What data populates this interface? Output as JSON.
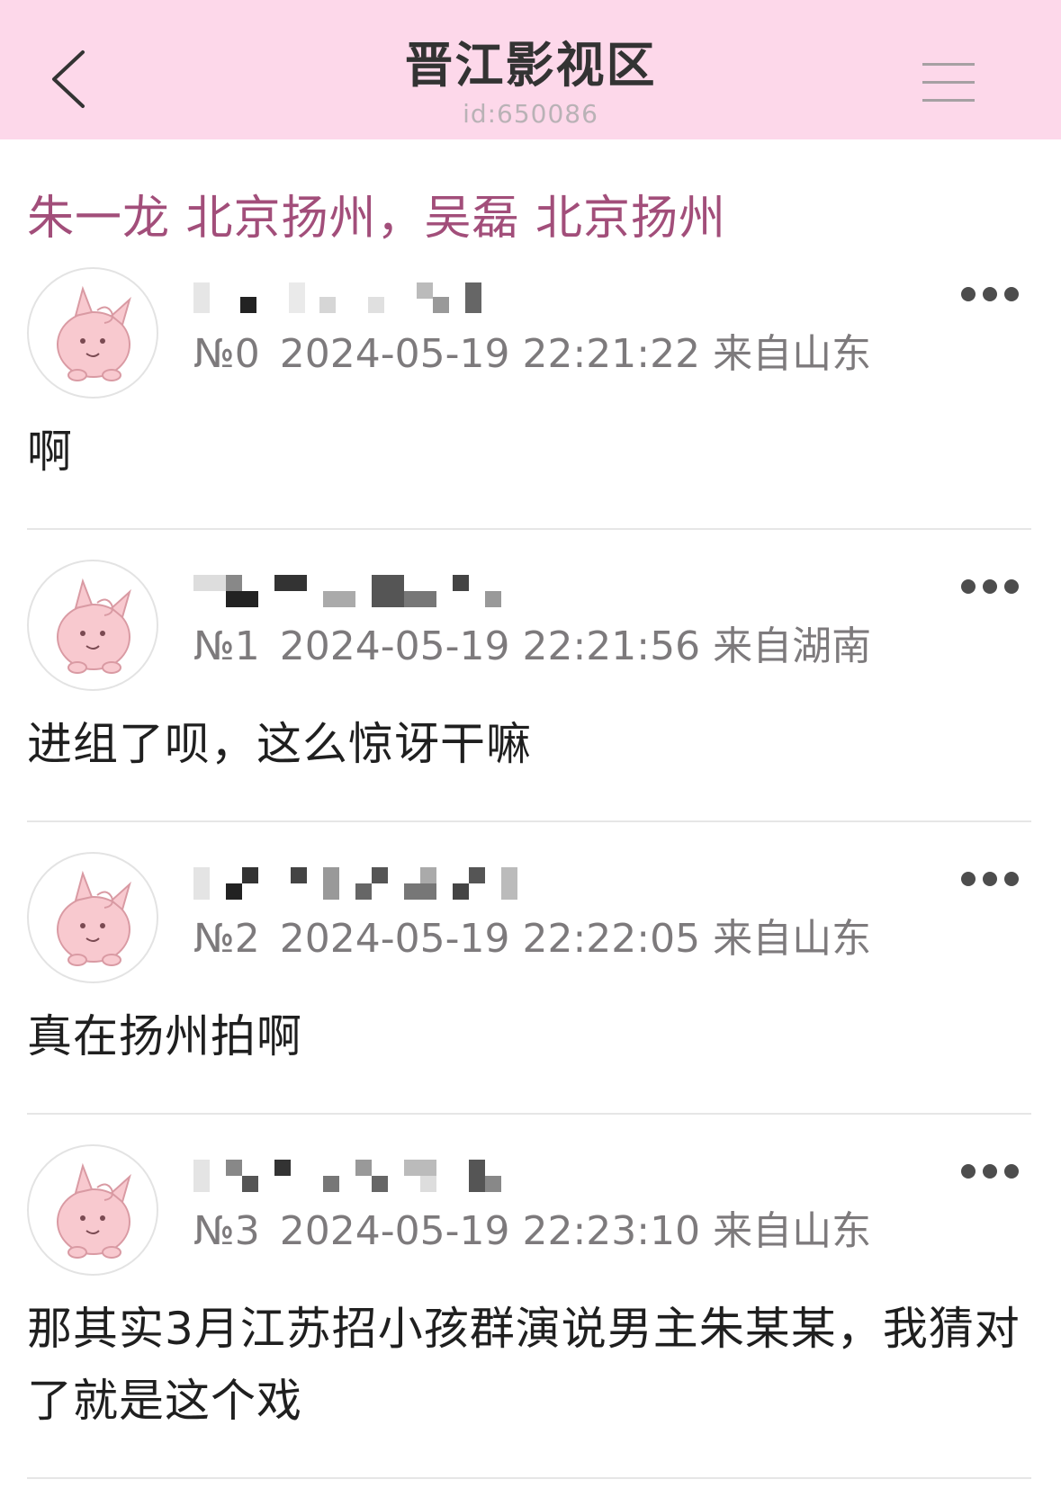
{
  "header": {
    "title": "晋江影视区",
    "subtitle": "id:650086",
    "background": "#fdd8ea"
  },
  "thread": {
    "title": "朱一龙 北京扬州，吴磊 北京扬州",
    "title_color": "#a24e7a"
  },
  "posts": [
    {
      "floor": "№0",
      "datetime": "2024-05-19 22:21:22",
      "location": "来自山东",
      "content": "啊"
    },
    {
      "floor": "№1",
      "datetime": "2024-05-19 22:21:56",
      "location": "来自湖南",
      "content": "进组了呗，这么惊讶干嘛"
    },
    {
      "floor": "№2",
      "datetime": "2024-05-19 22:22:05",
      "location": "来自山东",
      "content": "真在扬州拍啊"
    },
    {
      "floor": "№3",
      "datetime": "2024-05-19 22:23:10",
      "location": "来自山东",
      "content": "那其实3月江苏招小孩群演说男主朱某某，我猜对了就是这个戏"
    }
  ],
  "icons": {
    "back": "chevron-left-icon",
    "menu": "hamburger-menu-icon",
    "more": "more-horizontal-icon",
    "avatar": "pink-creature-avatar"
  }
}
